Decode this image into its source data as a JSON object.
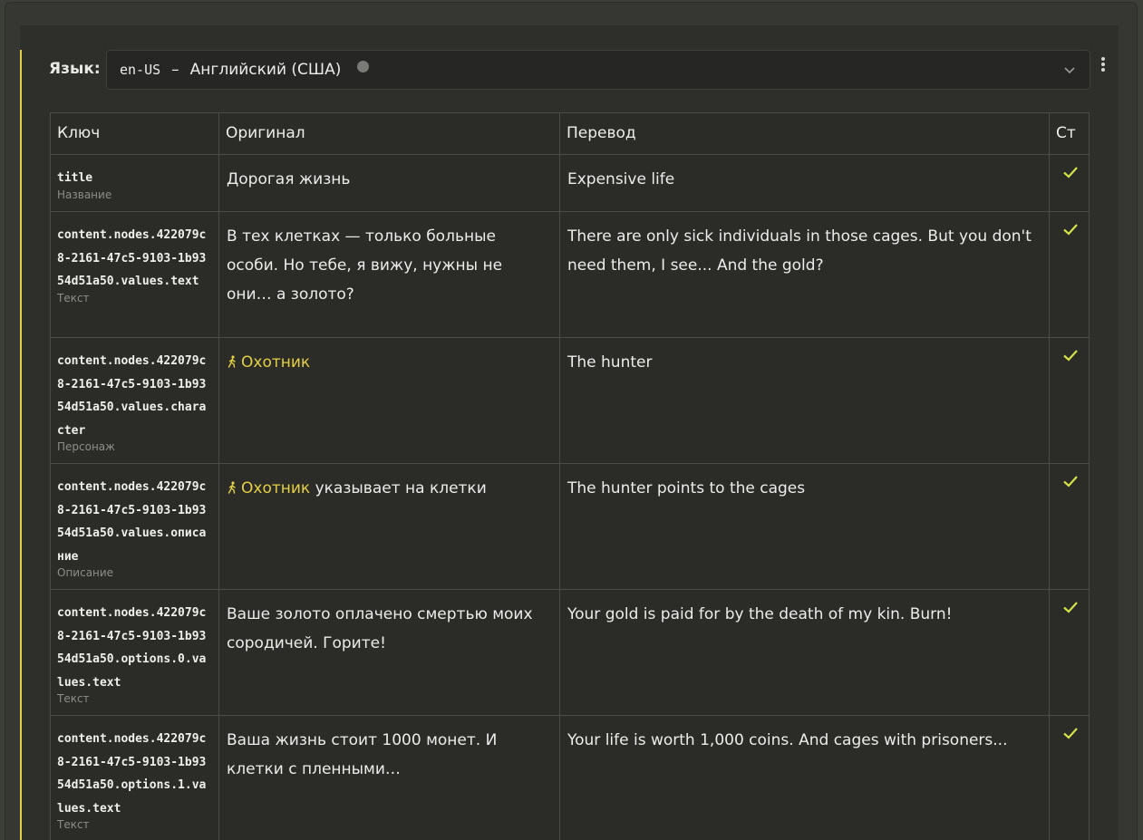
{
  "language": {
    "label": "Язык:",
    "code": "en-US",
    "separator": "–",
    "name": "Английский (США)"
  },
  "table": {
    "headers": {
      "key": "Ключ",
      "original": "Оригинал",
      "translation": "Перевод",
      "status": "Ст"
    },
    "rows": [
      {
        "key": "title",
        "type": "Название",
        "original": "Дорогая жизнь",
        "translation": "Expensive life",
        "status": "check-icon"
      },
      {
        "key": "content.nodes.422079c8-2161-47c5-9103-1b9354d51a50.values.text",
        "type": "Текст",
        "original": "В тех клетках — только больные особи. Но тебе, я вижу, нужны не они… а золото?",
        "translation": "There are only sick individuals in those cages. But you don't need them, I see... And the gold?",
        "status": "check-icon"
      },
      {
        "key": "content.nodes.422079c8-2161-47c5-9103-1b9354d51a50.values.character",
        "type": "Персонаж",
        "original_character": "Охотник",
        "original_rest": "",
        "translation": "The hunter",
        "status": "check-icon"
      },
      {
        "key": "content.nodes.422079c8-2161-47c5-9103-1b9354d51a50.values.описание",
        "type": "Описание",
        "original_character": "Охотник",
        "original_rest": " указывает на клетки",
        "translation": "The hunter points to the cages",
        "status": "check-icon"
      },
      {
        "key": "content.nodes.422079c8-2161-47c5-9103-1b9354d51a50.options.0.values.text",
        "type": "Текст",
        "original": "Ваше золото оплачено смертью моих сородичей. Горите!",
        "translation": "Your gold is paid for by the death of my kin. Burn!",
        "status": "check-icon"
      },
      {
        "key": "content.nodes.422079c8-2161-47c5-9103-1b9354d51a50.options.1.values.text",
        "type": "Текст",
        "original": "Ваша жизнь стоит 1000 монет. И клетки с пленными…",
        "translation": "Your life is worth 1,000 coins. And cages with prisoners...",
        "status": "check-icon"
      }
    ]
  },
  "colors": {
    "accent": "#e2cf48",
    "character": "#e5cf43",
    "check": "#d4e24a"
  }
}
